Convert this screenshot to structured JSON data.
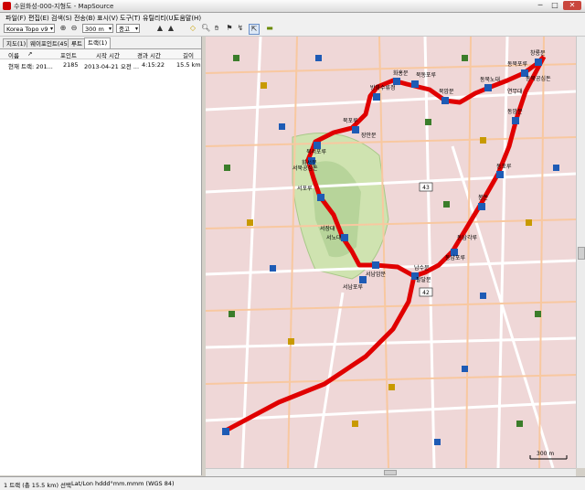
{
  "window": {
    "title": "수원화성-000-지형도 - MapSource",
    "minimize": "─",
    "maximize": "□",
    "close": "✕"
  },
  "menu": [
    "파일(F)",
    "편집(E)",
    "검색(S)",
    "전송(B)",
    "표시(V)",
    "도구(T)",
    "유틸리티(U)",
    "도움말(H)"
  ],
  "toolbar": {
    "map_product": "Korea Topo v9",
    "zoom_scale": "300 m",
    "detail_level": "중고",
    "icons": [
      "zoom-in-icon",
      "zoom-out-icon",
      "gps-device-icon",
      "receive-icon",
      "select-tool-icon",
      "zoom-tool-icon",
      "pan-tool-icon",
      "waypoint-tool-icon",
      "route-tool-icon",
      "track-tool-icon",
      "cursor-icon",
      "distance-icon"
    ]
  },
  "tabs": [
    "지도(1)",
    "웨이포인트(45)",
    "루트",
    "트랙(1)"
  ],
  "table": {
    "headers": [
      "이름",
      "포인트",
      "시작 시간",
      "경과 시간",
      "길이"
    ],
    "rows": [
      [
        "현재 트랙: 201...",
        "2185",
        "2013-04-21 오전 ...",
        "4:15:22",
        "15.5 km"
      ]
    ]
  },
  "map": {
    "labels": [
      "창룡문",
      "동북포루",
      "동북공심돈",
      "연무대",
      "동암문",
      "동포루",
      "봉돈",
      "동남각루",
      "동남포루",
      "남수문",
      "팔달문",
      "서남암문",
      "서남포루",
      "서장대",
      "서노대",
      "서포루",
      "서북공심돈",
      "화서문",
      "장안문",
      "북서포루",
      "북포루",
      "방화수류정",
      "화홍문",
      "북동포루",
      "북암문",
      "동북노대",
      "43",
      "42",
      "300 m"
    ],
    "highway_shields": [
      "43",
      "42"
    ],
    "scale": "300 m",
    "colors": {
      "background": "#efd7d7",
      "park": "#cfe3b0",
      "track": "#e00000",
      "road": "#ffffff"
    }
  },
  "status": {
    "selection": "1 트랙 (총 15.5 km) 선택",
    "coords": "Lat/Lon hddd°mm.mmm (WGS 84)"
  }
}
